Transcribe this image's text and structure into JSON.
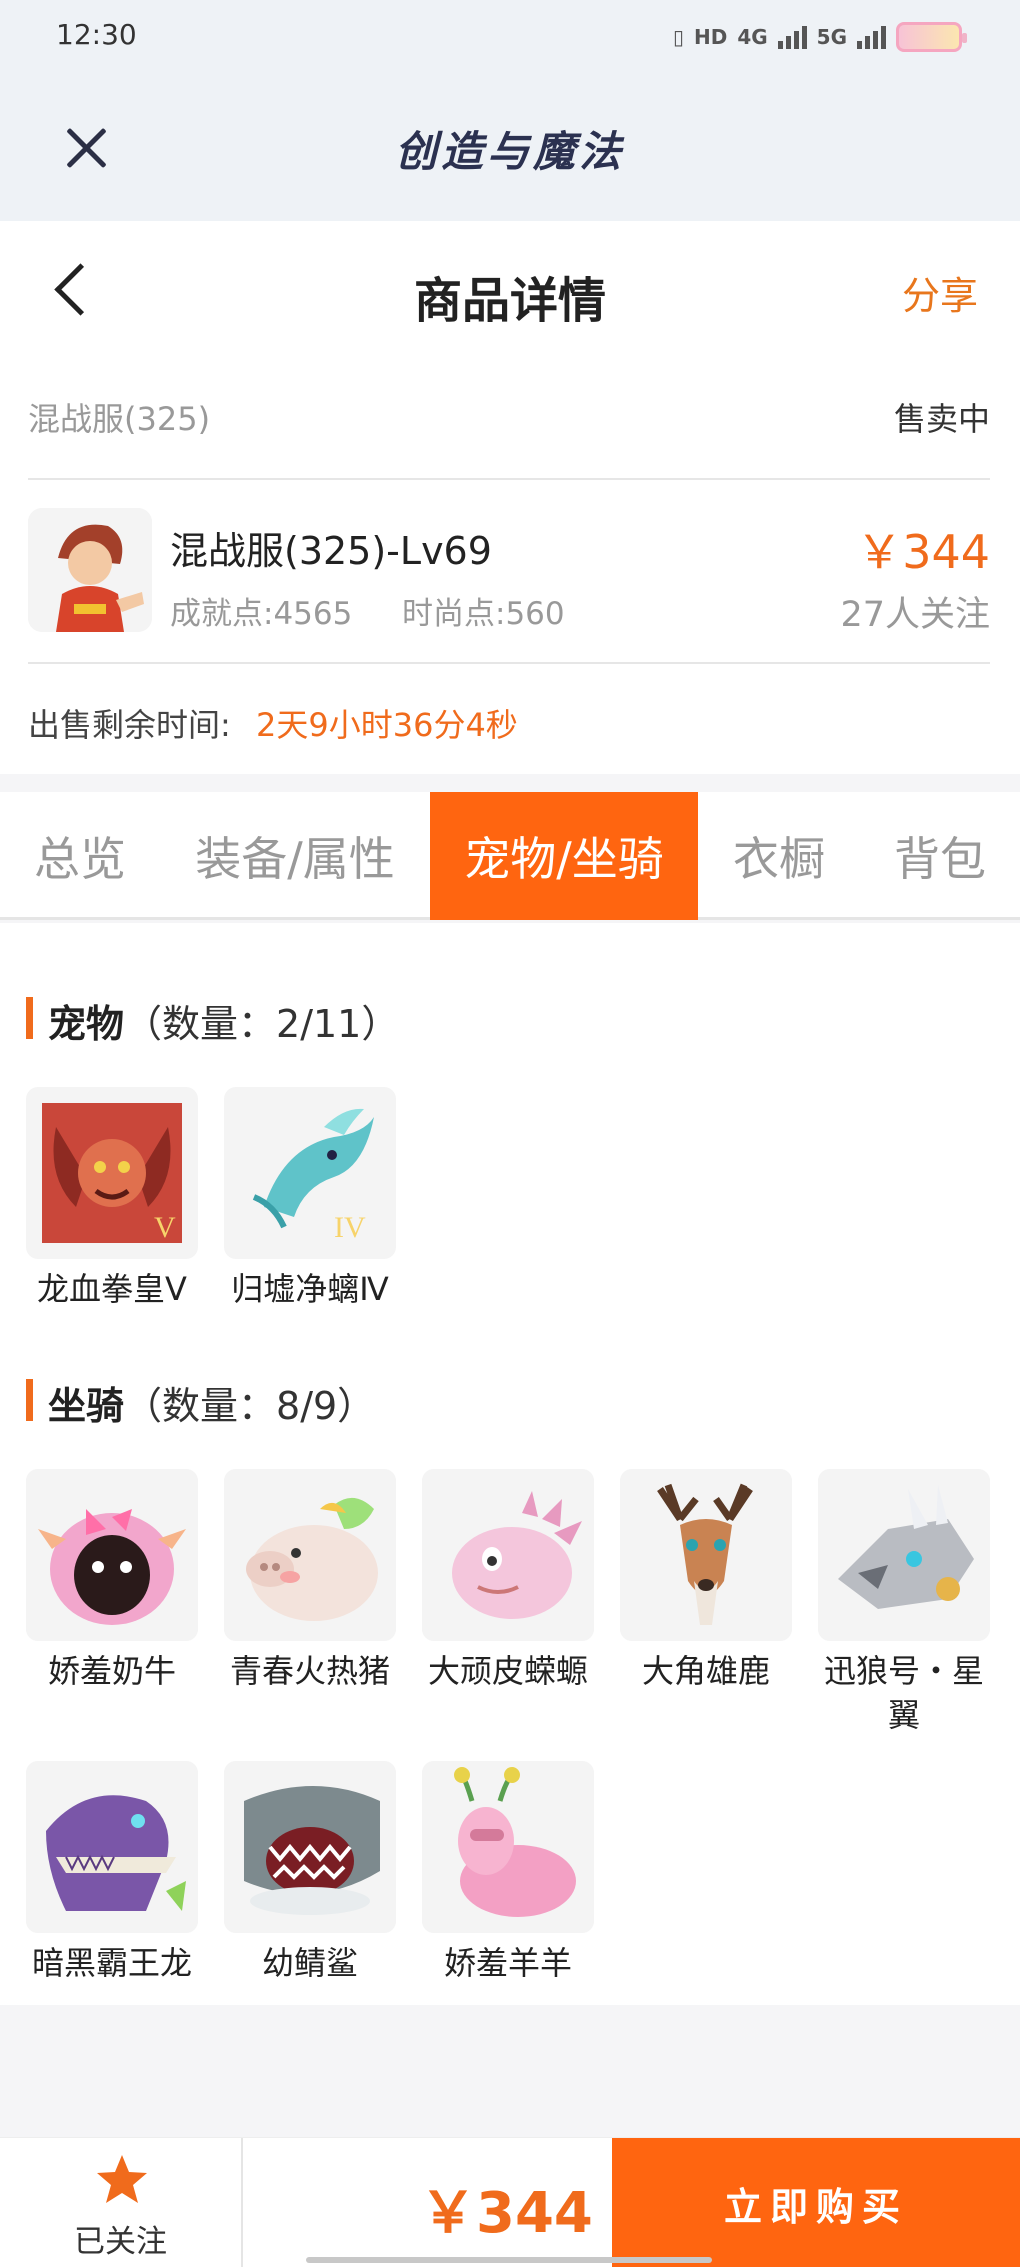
{
  "status_bar": {
    "time": "12:30",
    "hd": "HD",
    "net1": "4G",
    "net2": "5G"
  },
  "app": {
    "title": "创造与魔法"
  },
  "header": {
    "title": "商品详情",
    "share": "分享"
  },
  "product": {
    "server": "混战服(325)",
    "status": "售卖中",
    "role_name": "混战服(325)-Lv69",
    "achievement": "成就点:4565",
    "fashion": "时尚点:560",
    "price": "￥344",
    "followers": "27人关注",
    "remain_label": "出售剩余时间:",
    "remain_value": "2天9小时36分4秒"
  },
  "tabs": [
    {
      "label": "总览",
      "active": false
    },
    {
      "label": "装备/属性",
      "active": false
    },
    {
      "label": "宠物/坐骑",
      "active": true
    },
    {
      "label": "衣橱",
      "active": false
    },
    {
      "label": "背包",
      "active": false
    }
  ],
  "pets": {
    "title": "宠物",
    "count": "（数量：2/11）",
    "items": [
      {
        "name": "龙血拳皇Ⅴ",
        "icon": "dragon-fist-king-icon",
        "color": "#c9473a"
      },
      {
        "name": "归墟净螭Ⅳ",
        "icon": "ocean-dragon-icon",
        "color": "#5fc3c9"
      }
    ]
  },
  "mounts": {
    "title": "坐骑",
    "count": "（数量：8/9）",
    "items": [
      {
        "name": "娇羞奶牛",
        "icon": "shy-cow-icon",
        "color": "#f2a6cc"
      },
      {
        "name": "青春火热猪",
        "icon": "pig-icon",
        "color": "#f3e3dc"
      },
      {
        "name": "大顽皮蝾螈",
        "icon": "axolotl-icon",
        "color": "#f4c6dc"
      },
      {
        "name": "大角雄鹿",
        "icon": "stag-icon",
        "color": "#c98352"
      },
      {
        "name": "迅狼号・星翼",
        "icon": "mech-wolf-icon",
        "color": "#b9bcc2"
      },
      {
        "name": "暗黑霸王龙",
        "icon": "dark-trex-icon",
        "color": "#7a56a8"
      },
      {
        "name": "幼鲭鲨",
        "icon": "shark-icon",
        "color": "#7d8a8e"
      },
      {
        "name": "娇羞羊羊",
        "icon": "shy-sheep-icon",
        "color": "#f3a0c4"
      }
    ]
  },
  "bottom": {
    "follow_label": "已关注",
    "price": "￥344",
    "buy_label": "立即购买"
  }
}
